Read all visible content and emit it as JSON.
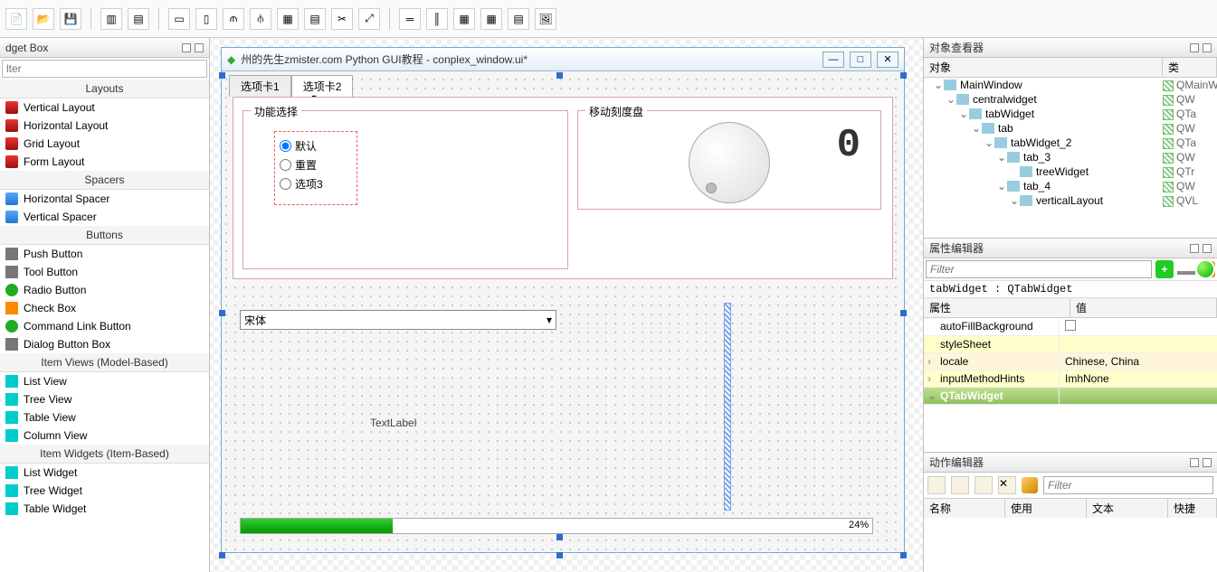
{
  "toolbar": {
    "buttons": 20
  },
  "left": {
    "title": "dget Box",
    "filter_placeholder": "lter",
    "groups": [
      {
        "name": "Layouts",
        "items": [
          "Vertical Layout",
          "Horizontal Layout",
          "Grid Layout",
          "Form Layout"
        ]
      },
      {
        "name": "Spacers",
        "items": [
          "Horizontal Spacer",
          "Vertical Spacer"
        ]
      },
      {
        "name": "Buttons",
        "items": [
          "Push Button",
          "Tool Button",
          "Radio Button",
          "Check Box",
          "Command Link Button",
          "Dialog Button Box"
        ]
      },
      {
        "name": "Item Views (Model-Based)",
        "items": [
          "List View",
          "Tree View",
          "Table View",
          "Column View"
        ]
      },
      {
        "name": "Item Widgets (Item-Based)",
        "items": [
          "List Widget",
          "Tree Widget",
          "Table Widget"
        ]
      }
    ]
  },
  "design": {
    "window_title": "州的先生zmister.com Python GUI教程 - conplex_window.ui*",
    "tabs": [
      "选项卡1",
      "选项卡2"
    ],
    "active_tab_index": 1,
    "group1_title": "功能选择",
    "radios": [
      "默认",
      "重置",
      "选项3"
    ],
    "radio_checked": 0,
    "group2_title": "移动刻度盘",
    "lcd_value": "0",
    "combo_value": "宋体",
    "text_label": "TextLabel",
    "progress_pct": 24
  },
  "objInspector": {
    "title": "对象查看器",
    "cols": [
      "对象",
      "类"
    ],
    "tree": [
      {
        "depth": 0,
        "tw": "v",
        "name": "MainWindow",
        "cls": "QMainW"
      },
      {
        "depth": 1,
        "tw": "v",
        "name": "centralwidget",
        "cls": "QW"
      },
      {
        "depth": 2,
        "tw": "v",
        "name": "tabWidget",
        "cls": "QTa"
      },
      {
        "depth": 3,
        "tw": "v",
        "name": "tab",
        "cls": "QW"
      },
      {
        "depth": 4,
        "tw": "v",
        "name": "tabWidget_2",
        "cls": "QTa"
      },
      {
        "depth": 5,
        "tw": "v",
        "name": "tab_3",
        "cls": "QW"
      },
      {
        "depth": 6,
        "tw": "",
        "name": "treeWidget",
        "cls": "QTr"
      },
      {
        "depth": 5,
        "tw": "v",
        "name": "tab_4",
        "cls": "QW"
      },
      {
        "depth": 6,
        "tw": "v",
        "name": "verticalLayout",
        "cls": "QVL"
      }
    ]
  },
  "propEditor": {
    "title": "属性编辑器",
    "filter_placeholder": "Filter",
    "object_line": "tabWidget : QTabWidget",
    "cols": [
      "属性",
      "值"
    ],
    "rows": [
      {
        "name": "autoFillBackground",
        "val": "",
        "checkbox": true,
        "cls": ""
      },
      {
        "name": "styleSheet",
        "val": "",
        "cls": "yellow"
      },
      {
        "name": "locale",
        "val": "Chinese, China",
        "cls": "beige",
        "exp": ">"
      },
      {
        "name": "inputMethodHints",
        "val": "ImhNone",
        "cls": "yellow",
        "exp": ">"
      },
      {
        "name": "QTabWidget",
        "val": "",
        "cls": "section",
        "exp": "v"
      }
    ]
  },
  "actionEditor": {
    "title": "动作编辑器",
    "filter_placeholder": "Filter",
    "cols": [
      "名称",
      "使用",
      "文本",
      "快捷"
    ]
  }
}
